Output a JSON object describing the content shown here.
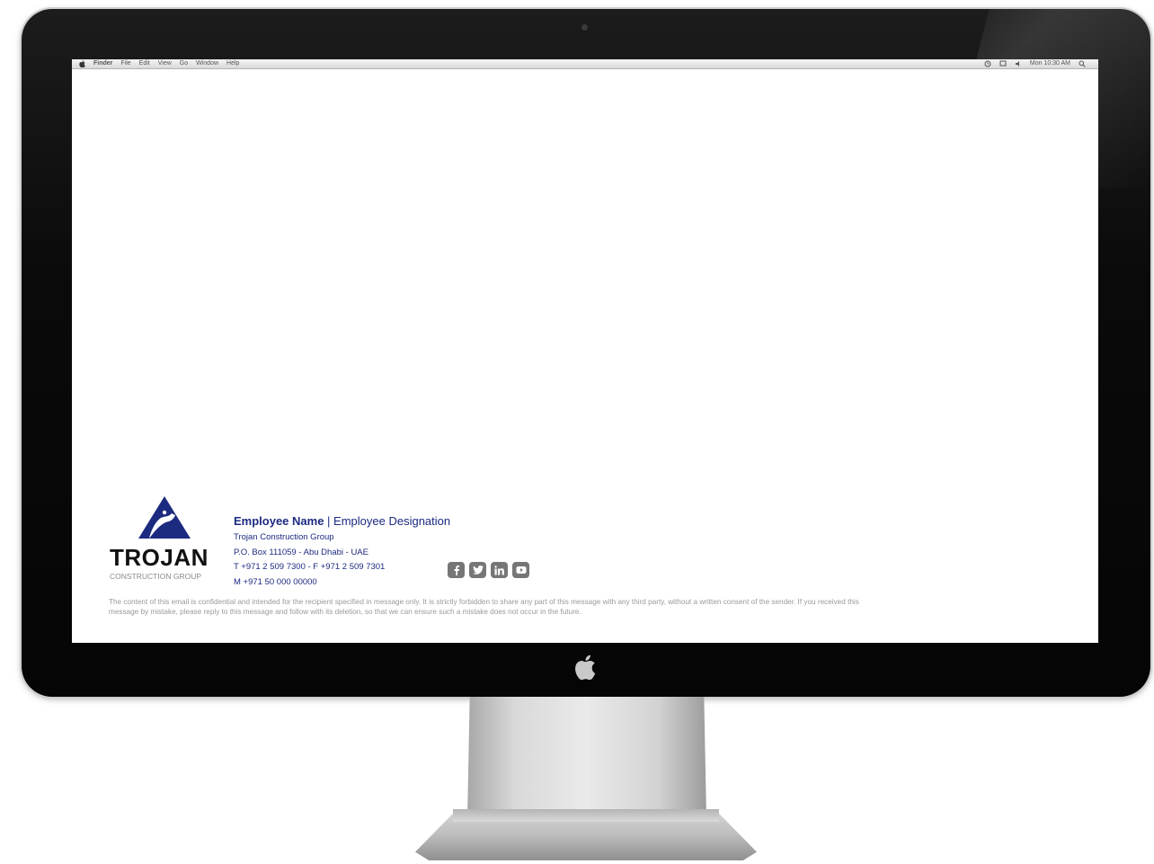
{
  "menubar": {
    "app_name": "Finder",
    "menus": [
      "File",
      "Edit",
      "View",
      "Go",
      "Window",
      "Help"
    ],
    "clock": "Mon 10:30 AM"
  },
  "brand": {
    "name": "TROJAN",
    "subtitle": "CONSTRUCTION GROUP",
    "color": "#1c2a80"
  },
  "signature": {
    "employee_name": "Employee Name",
    "separator": " | ",
    "employee_designation": "Employee Designation",
    "company": "Trojan Construction Group",
    "address": "P.O. Box 111059 - Abu Dhabi - UAE",
    "phone_fax": "T +971 2 509 7300 - F +971 2 509 7301",
    "mobile": "M +971 50 000 00000"
  },
  "social": [
    {
      "icon": "facebook-icon"
    },
    {
      "icon": "twitter-icon"
    },
    {
      "icon": "linkedin-icon"
    },
    {
      "icon": "youtube-icon"
    }
  ],
  "disclaimer": "The content of this email is confidential and intended for the recipient specified in message only. It is strictly forbidden to share any part of this message with any third party, without a written consent of the sender. If you received this message by mistake, please reply to this message and follow with its deletion, so that we can ensure such a mistake does not occur in the future."
}
